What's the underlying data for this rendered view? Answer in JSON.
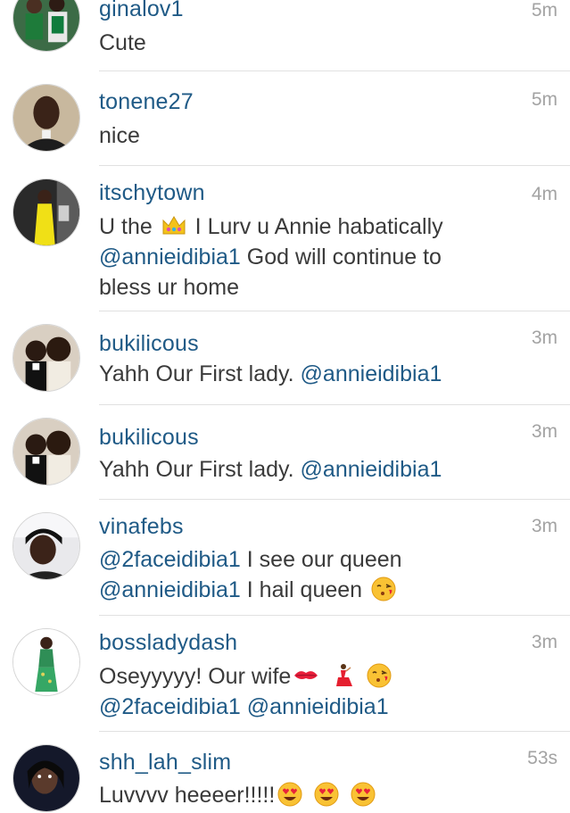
{
  "comments": [
    {
      "username": "ginalov1",
      "time": "5m",
      "text": "Cute",
      "avatar": "group-photo-avatar"
    },
    {
      "username": "tonene27",
      "time": "5m",
      "text": "nice",
      "avatar": "man-portrait-avatar"
    },
    {
      "username": "itschytown",
      "time": "4m",
      "text_a": "U the",
      "emoji_a": "crown",
      "text_b": "I Lurv u Annie habatically",
      "mention": "@annieidibia1",
      "text_c": "God will continue to",
      "text_d": "bless ur home",
      "avatar": "yellow-dress-avatar"
    },
    {
      "username": "bukilicous",
      "time": "3m",
      "text_a": "Yahh Our First lady.",
      "mention": "@annieidibia1",
      "avatar": "two-kids-avatar"
    },
    {
      "username": "bukilicous",
      "time": "3m",
      "text_a": "Yahh Our First lady.",
      "mention": "@annieidibia1",
      "avatar": "two-kids-avatar"
    },
    {
      "username": "vinafebs",
      "time": "3m",
      "mention_a": "@2faceidibia1",
      "text_a": "I see our queen",
      "mention_b": "@annieidibia1",
      "text_b": "I hail queen",
      "emoji_a": "face-blowing-kiss",
      "avatar": "woman-selfie-avatar"
    },
    {
      "username": "bossladydash",
      "time": "3m",
      "text_a": "Oseyyyyy! Our wife",
      "emoji_a": "kiss-mark",
      "emoji_b": "dancer",
      "emoji_c": "face-blowing-kiss",
      "mention_a": "@2faceidibia1",
      "mention_b": "@annieidibia1",
      "avatar": "woman-green-dress-avatar"
    },
    {
      "username": "shh_lah_slim",
      "time": "53s",
      "text_a": "Luvvvv heeeer!!!!!",
      "emoji_a": "heart-eyes",
      "emoji_b": "heart-eyes",
      "emoji_c": "heart-eyes",
      "avatar": "woman-dark-photo-avatar"
    }
  ],
  "colors": {
    "username": "#1f5a86",
    "time": "#a3a3a3",
    "text": "#3a3a3a",
    "divider": "#e1e1e1"
  }
}
